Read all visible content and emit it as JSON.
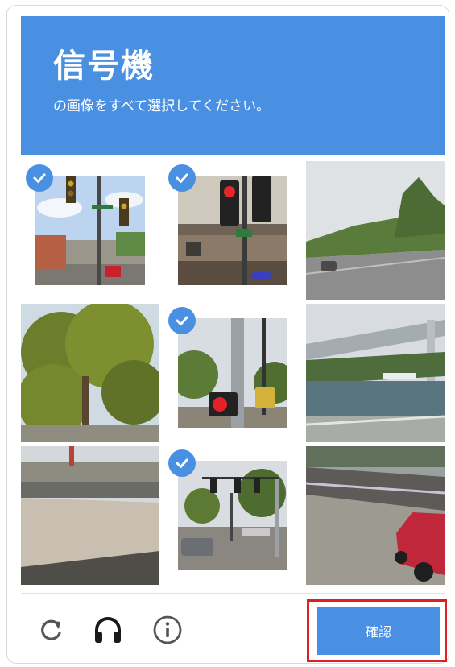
{
  "header": {
    "title": "信号機",
    "subtitle": "の画像をすべて選択してください。"
  },
  "tiles": [
    {
      "selected": true,
      "scene": "street-traffic-lights"
    },
    {
      "selected": true,
      "scene": "traffic-signal-pole"
    },
    {
      "selected": false,
      "scene": "highway"
    },
    {
      "selected": false,
      "scene": "trees"
    },
    {
      "selected": true,
      "scene": "pedestrian-signal"
    },
    {
      "selected": false,
      "scene": "river-bridge"
    },
    {
      "selected": false,
      "scene": "roadside"
    },
    {
      "selected": true,
      "scene": "intersection-signals"
    },
    {
      "selected": false,
      "scene": "red-car-road"
    }
  ],
  "footer": {
    "verify_label": "確認",
    "icons": [
      "reload-icon",
      "headphones-icon",
      "info-icon"
    ]
  },
  "colors": {
    "accent": "#4a90e2",
    "highlight_border": "#e02020"
  }
}
